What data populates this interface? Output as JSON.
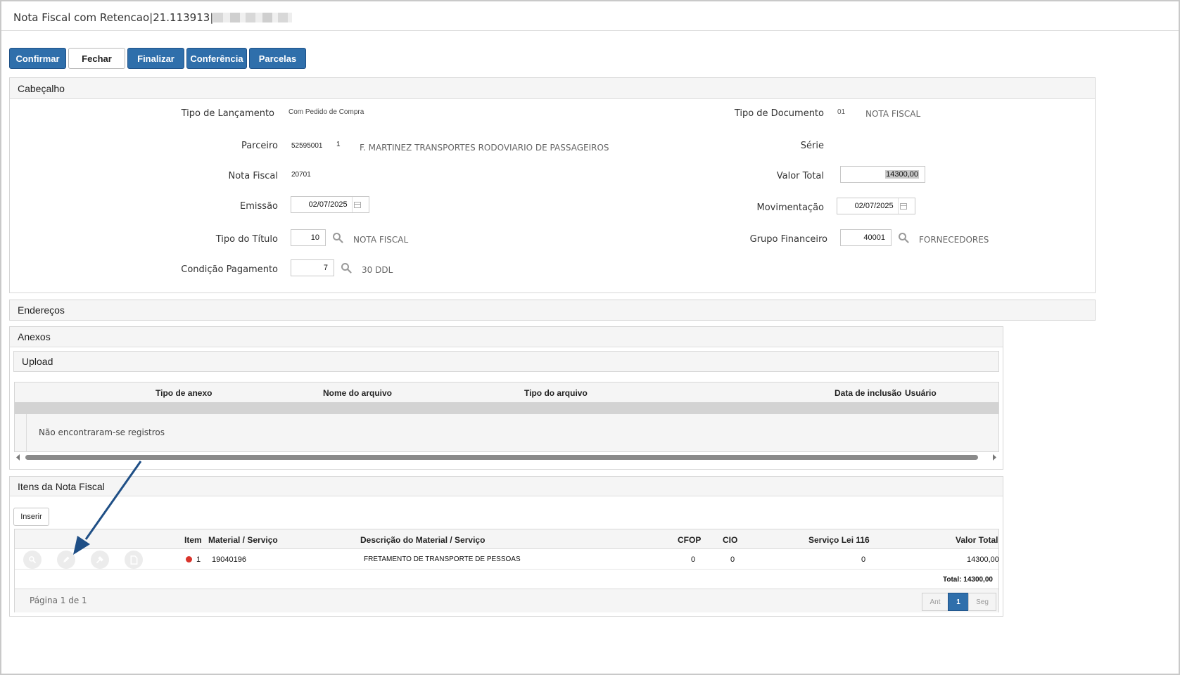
{
  "window": {
    "title": "Nota Fiscal com Retencao|21.113913|"
  },
  "toolbar": {
    "confirmar": "Confirmar",
    "fechar": "Fechar",
    "finalizar": "Finalizar",
    "conferencia": "Conferência",
    "parcelas": "Parcelas"
  },
  "cabecalho": {
    "title": "Cabeçalho",
    "tipo_lancamento_label": "Tipo de Lançamento",
    "tipo_lancamento_value": "Com Pedido de Compra",
    "tipo_documento_label": "Tipo de Documento",
    "tipo_documento_code": "01",
    "tipo_documento_desc": "NOTA FISCAL",
    "parceiro_label": "Parceiro",
    "parceiro_code": "52595001",
    "parceiro_seq": "1",
    "parceiro_name": "F. MARTINEZ TRANSPORTES RODOVIARIO DE PASSAGEIROS",
    "serie_label": "Série",
    "nota_fiscal_label": "Nota Fiscal",
    "nota_fiscal_value": "20701",
    "valor_total_label": "Valor Total",
    "valor_total_value": "14300,00",
    "emissao_label": "Emissão",
    "emissao_value": "02/07/2025",
    "movimentacao_label": "Movimentação",
    "movimentacao_value": "02/07/2025",
    "tipo_titulo_label": "Tipo do Título",
    "tipo_titulo_value": "10",
    "tipo_titulo_desc": "NOTA FISCAL",
    "grupo_financeiro_label": "Grupo Financeiro",
    "grupo_financeiro_value": "40001",
    "grupo_financeiro_desc": "FORNECEDORES",
    "condicao_pagamento_label": "Condição Pagamento",
    "condicao_pagamento_value": "7",
    "condicao_pagamento_desc": "30 DDL"
  },
  "enderecos": {
    "title": "Endereços"
  },
  "anexos": {
    "title": "Anexos",
    "upload_title": "Upload",
    "columns": {
      "tipo_anexo": "Tipo de anexo",
      "nome_arquivo": "Nome do arquivo",
      "tipo_arquivo": "Tipo do arquivo",
      "data_inclusao": "Data de inclusão",
      "usuario": "Usuário"
    },
    "empty_message": "Não encontraram-se registros"
  },
  "itens": {
    "title": "Itens da Nota Fiscal",
    "inserir": "Inserir",
    "columns": {
      "item": "Item",
      "material": "Material / Serviço",
      "descricao": "Descrição do Material / Serviço",
      "cfop": "CFOP",
      "cio": "CIO",
      "servico_lei": "Serviço Lei 116",
      "valor_total": "Valor Total"
    },
    "rows": [
      {
        "item": "1",
        "material": "19040196",
        "descricao": "FRETAMENTO DE TRANSPORTE DE PESSOAS",
        "cfop": "0",
        "cio": "0",
        "servico_lei": "0",
        "valor_total": "14300,00",
        "status_color": "#d9342b"
      }
    ],
    "total": "Total: 14300,00",
    "pagination": {
      "text": "Página 1 de 1",
      "prev": "Ant",
      "current": "1",
      "next": "Seg"
    }
  },
  "colors": {
    "primary": "#2f6fab",
    "status_red": "#d9342b",
    "arrow": "#1f4f86"
  }
}
